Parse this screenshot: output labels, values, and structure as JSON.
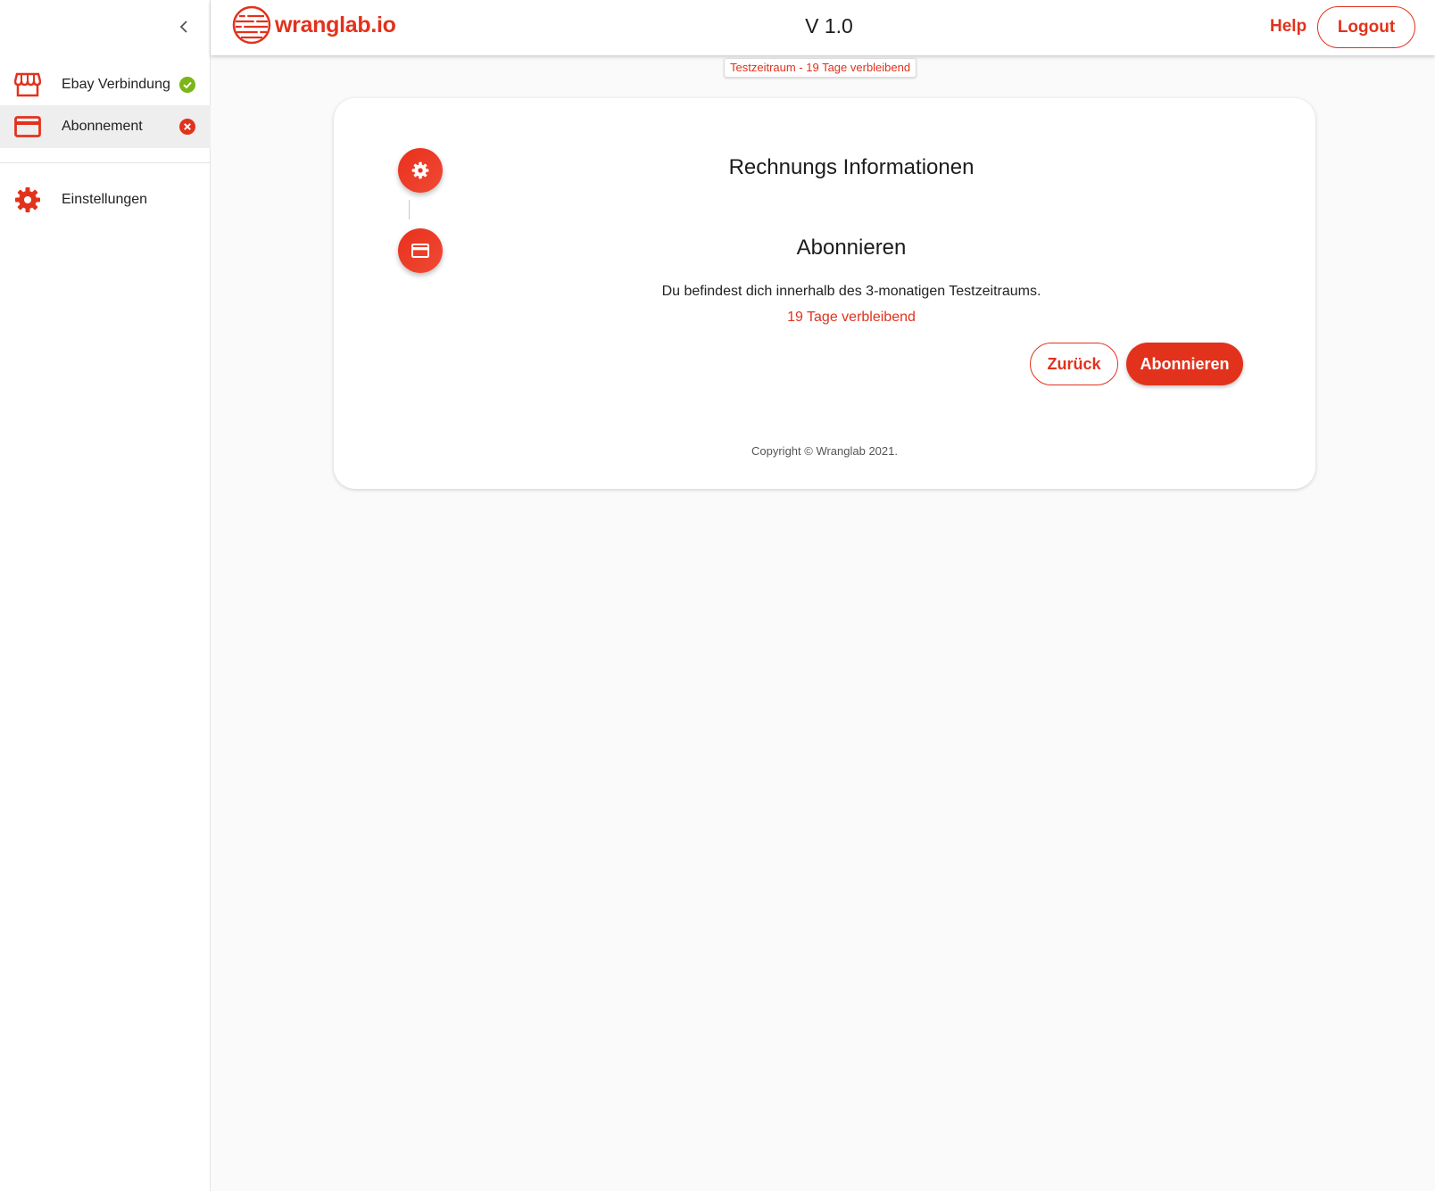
{
  "sidebar": {
    "collapse_icon": "chevron-left-icon",
    "items": [
      {
        "label": "Ebay Verbindung",
        "icon": "store-icon",
        "status": "check-circle-icon",
        "status_color": "#7cb518"
      },
      {
        "label": "Abonnement",
        "icon": "credit-card-icon",
        "status": "error-circle-icon",
        "status_color": "#e2321c"
      },
      {
        "label": "Einstellungen",
        "icon": "gear-icon"
      }
    ]
  },
  "header": {
    "logo_text": "wranglab.io",
    "version": "V 1.0",
    "help_label": "Help",
    "logout_label": "Logout"
  },
  "trial_badge": "Testzeitraum - 19 Tage verbleibend",
  "card": {
    "steps": [
      {
        "title": "Rechnungs Informationen",
        "icon": "gear-icon"
      },
      {
        "title": "Abonnieren",
        "icon": "credit-card-icon"
      }
    ],
    "description": "Du befindest dich innerhalb des 3-monatigen Testzeitraums.",
    "remaining": "19 Tage verbleibend",
    "back_label": "Zurück",
    "subscribe_label": "Abonnieren",
    "copyright": "Copyright © Wranglab 2021."
  },
  "colors": {
    "accent": "#e2321c",
    "success": "#7cb518",
    "background": "#fafafa"
  }
}
